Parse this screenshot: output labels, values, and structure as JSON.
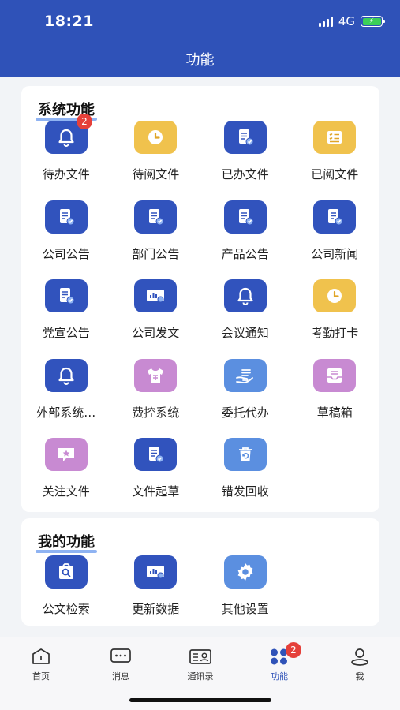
{
  "status": {
    "time": "18:21",
    "network": "4G"
  },
  "nav": {
    "title": "功能"
  },
  "system_section": {
    "title": "系统功能",
    "items": [
      {
        "label": "待办文件",
        "icon": "bell-icon",
        "color": "#3153bd",
        "badge": "2"
      },
      {
        "label": "待阅文件",
        "icon": "clock-icon",
        "color": "#f0c24d"
      },
      {
        "label": "已办文件",
        "icon": "document-check-icon",
        "color": "#3153bd"
      },
      {
        "label": "已阅文件",
        "icon": "checklist-icon",
        "color": "#f0c24d"
      },
      {
        "label": "公司公告",
        "icon": "document-check-icon",
        "color": "#3153bd"
      },
      {
        "label": "部门公告",
        "icon": "document-check-icon",
        "color": "#3153bd"
      },
      {
        "label": "产品公告",
        "icon": "document-check-icon",
        "color": "#3153bd"
      },
      {
        "label": "公司新闻",
        "icon": "document-check-icon",
        "color": "#3153bd"
      },
      {
        "label": "党宣公告",
        "icon": "document-check-icon",
        "color": "#3153bd"
      },
      {
        "label": "公司发文",
        "icon": "chart-board-icon",
        "color": "#3153bd"
      },
      {
        "label": "会议通知",
        "icon": "bell-icon",
        "color": "#3153bd"
      },
      {
        "label": "考勤打卡",
        "icon": "clock-icon",
        "color": "#f0c24d"
      },
      {
        "label": "外部系统…",
        "icon": "bell-icon",
        "color": "#3153bd"
      },
      {
        "label": "费控系统",
        "icon": "shirt-icon",
        "color": "#c88ad2"
      },
      {
        "label": "委托代办",
        "icon": "hand-list-icon",
        "color": "#5b8fe0"
      },
      {
        "label": "草稿箱",
        "icon": "inbox-icon",
        "color": "#c88ad2"
      },
      {
        "label": "关注文件",
        "icon": "star-icon",
        "color": "#c88ad2"
      },
      {
        "label": "文件起草",
        "icon": "document-check-icon",
        "color": "#3153bd"
      },
      {
        "label": "错发回收",
        "icon": "recycle-bin-icon",
        "color": "#5b8fe0"
      }
    ]
  },
  "my_section": {
    "title": "我的功能",
    "items": [
      {
        "label": "公文检索",
        "icon": "search-doc-icon",
        "color": "#3153bd"
      },
      {
        "label": "更新数据",
        "icon": "chart-board-icon",
        "color": "#3153bd"
      },
      {
        "label": "其他设置",
        "icon": "gear-icon",
        "color": "#5b8fe0"
      }
    ]
  },
  "tabbar": {
    "active": 3,
    "tabs": [
      {
        "label": "首页",
        "icon": "home-icon"
      },
      {
        "label": "消息",
        "icon": "message-icon"
      },
      {
        "label": "通讯录",
        "icon": "contacts-icon"
      },
      {
        "label": "功能",
        "icon": "apps-icon",
        "badge": "2"
      },
      {
        "label": "我",
        "icon": "user-icon"
      }
    ]
  }
}
